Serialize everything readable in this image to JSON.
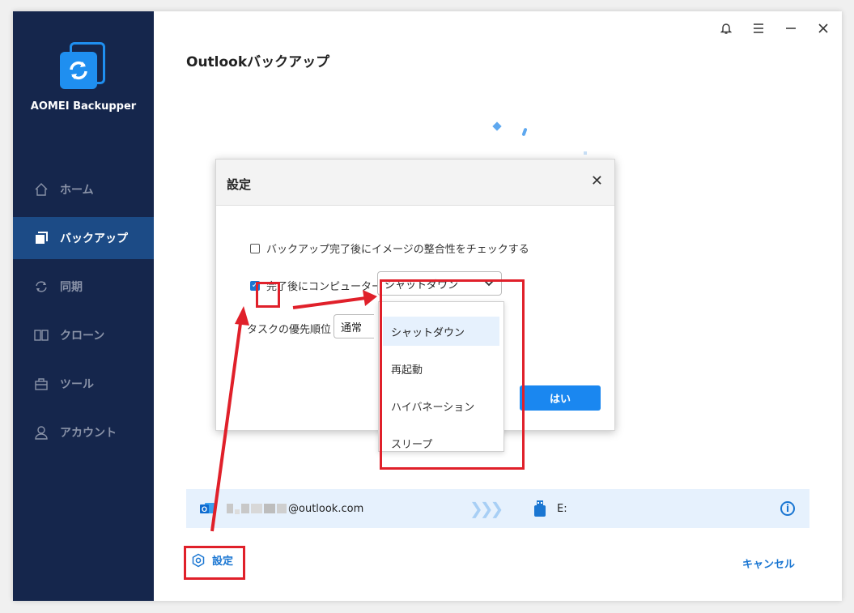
{
  "app": {
    "name": "AOMEI Backupper"
  },
  "sidebar": {
    "items": [
      {
        "label": "ホーム",
        "icon": "home-icon"
      },
      {
        "label": "バックアップ",
        "icon": "backup-icon"
      },
      {
        "label": "同期",
        "icon": "sync-icon"
      },
      {
        "label": "クローン",
        "icon": "clone-icon"
      },
      {
        "label": "ツール",
        "icon": "tools-icon"
      },
      {
        "label": "アカウント",
        "icon": "account-icon"
      }
    ],
    "active_index": 1
  },
  "titlebar": {
    "icons": [
      "bell-icon",
      "menu-icon",
      "minimize-icon",
      "close-icon"
    ]
  },
  "page": {
    "title": "Outlookバックアップ"
  },
  "path": {
    "source_email": "@outlook.com",
    "destination": "E:"
  },
  "footer": {
    "settings_label": "設定",
    "cancel_label": "キャンセル"
  },
  "dialog": {
    "title": "設定",
    "check_integrity_label": "バックアップ完了後にイメージの整合性をチェックする",
    "check_integrity_checked": false,
    "after_complete_label": "完了後にコンピューターを",
    "after_complete_checked": true,
    "after_complete_value": "シャットダウン",
    "priority_label": "タスクの優先順位",
    "priority_value": "通常",
    "ok_label": "はい"
  },
  "dropdown": {
    "options": [
      "シャットダウン",
      "再起動",
      "ハイバネーション",
      "スリープ"
    ],
    "selected_index": 0
  },
  "colors": {
    "sidebar": "#15264c",
    "accent": "#1a87f0",
    "annotation": "#e0202a"
  }
}
